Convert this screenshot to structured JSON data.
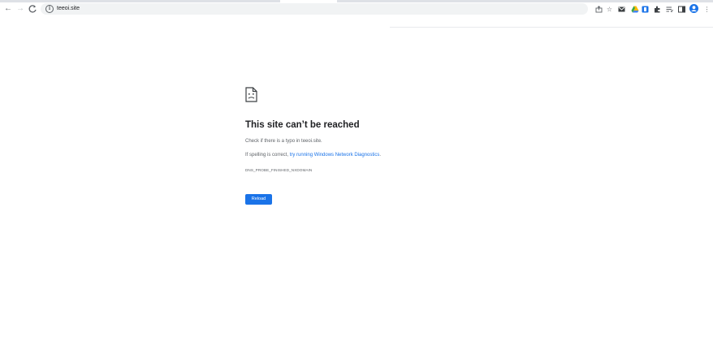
{
  "browser": {
    "url": "teeoi.site",
    "toolbar_icons": [
      "back-icon",
      "forward-icon",
      "reload-icon",
      "site-info-icon",
      "share-icon",
      "bookmark-star-icon",
      "gmail-extension-icon",
      "drive-extension-icon",
      "extension-blue-icon",
      "extensions-puzzle-icon",
      "reading-list-icon",
      "side-panel-icon",
      "profile-avatar-icon",
      "menu-kebab-icon"
    ]
  },
  "error_page": {
    "title": "This site can’t be reached",
    "line1": "Check if there is a typo in teeoi.site.",
    "line2_prefix": "If spelling is correct, ",
    "line2_link": "try running Windows Network Diagnostics",
    "line2_suffix": ".",
    "error_code": "DNS_PROBE_FINISHED_NXDOMAIN",
    "reload_label": "Reload"
  },
  "colors": {
    "accent": "#1a73e8",
    "text_primary": "#202124",
    "text_secondary": "#5f6368"
  }
}
